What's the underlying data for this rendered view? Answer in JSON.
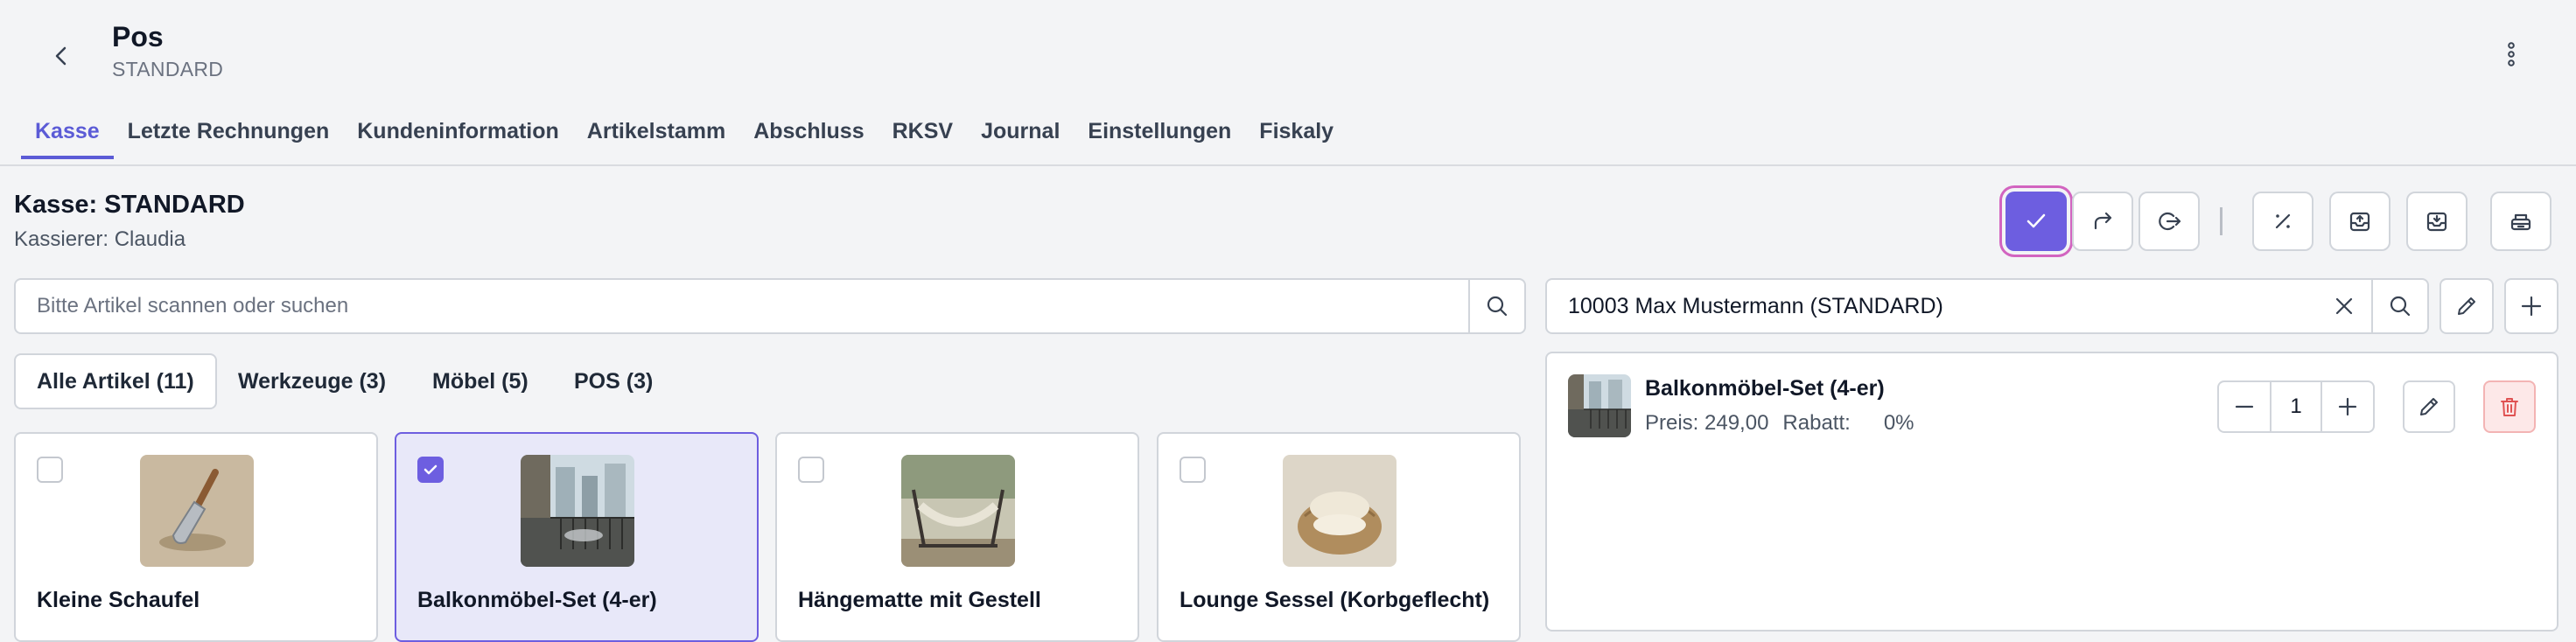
{
  "header": {
    "title": "Pos",
    "subtitle": "STANDARD"
  },
  "tabs": [
    {
      "label": "Kasse",
      "active": true
    },
    {
      "label": "Letzte Rechnungen"
    },
    {
      "label": "Kundeninformation"
    },
    {
      "label": "Artikelstamm"
    },
    {
      "label": "Abschluss"
    },
    {
      "label": "RKSV"
    },
    {
      "label": "Journal"
    },
    {
      "label": "Einstellungen"
    },
    {
      "label": "Fiskaly"
    }
  ],
  "register": {
    "title": "Kasse: STANDARD",
    "cashier": "Kassierer: Claudia"
  },
  "toolbar": [
    "check-icon",
    "forward-icon",
    "logout-icon",
    "percent-icon",
    "inbox-upload-icon",
    "inbox-download-icon",
    "cash-drawer-icon"
  ],
  "search": {
    "placeholder": "Bitte Artikel scannen oder suchen",
    "value": ""
  },
  "customer": {
    "value": "10003 Max Mustermann (STANDARD)"
  },
  "categories": [
    {
      "label": "Alle Artikel  (11)",
      "active": true
    },
    {
      "label": "Werkzeuge (3)"
    },
    {
      "label": "Möbel (5)"
    },
    {
      "label": "POS (3)"
    }
  ],
  "products": [
    {
      "name": "Kleine Schaufel",
      "selected": false
    },
    {
      "name": "Balkonmöbel-Set (4-er)",
      "selected": true
    },
    {
      "name": "Hängematte mit Gestell",
      "selected": false
    },
    {
      "name": "Lounge Sessel (Korbgeflecht)",
      "selected": false
    }
  ],
  "cart": {
    "items": [
      {
        "name": "Balkonmöbel-Set (4-er)",
        "price": "Preis: 249,00",
        "discount_label": "Rabatt:",
        "discount": "0%",
        "quantity": "1"
      }
    ]
  },
  "colors": {
    "accent": "#6d5ee0",
    "focus_ring": "#d264c0",
    "danger": "#e05252"
  }
}
